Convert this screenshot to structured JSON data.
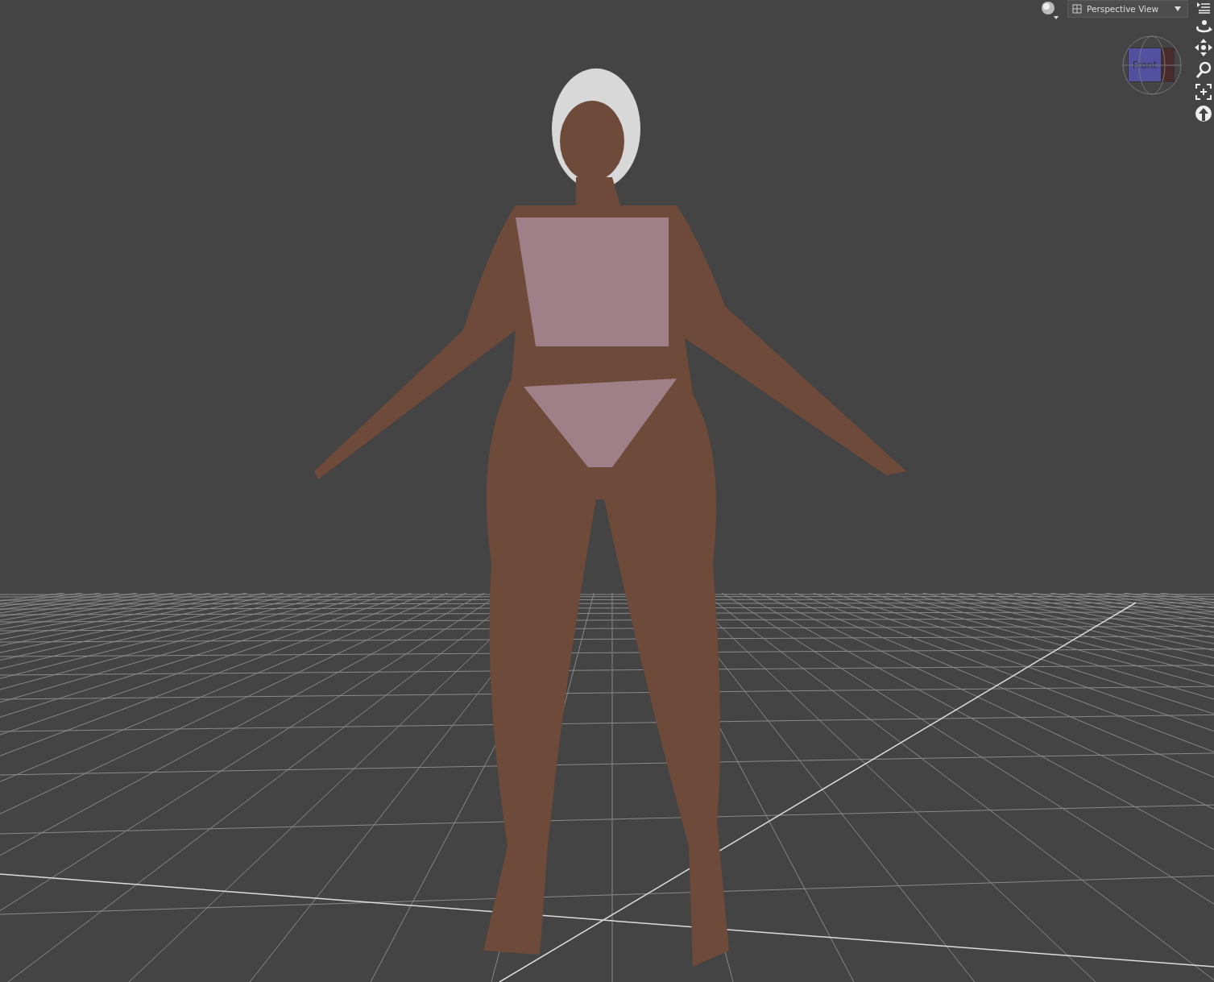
{
  "viewport": {
    "view_dropdown": {
      "label": "Perspective View"
    },
    "view_cube": {
      "face_label": "Front"
    }
  }
}
